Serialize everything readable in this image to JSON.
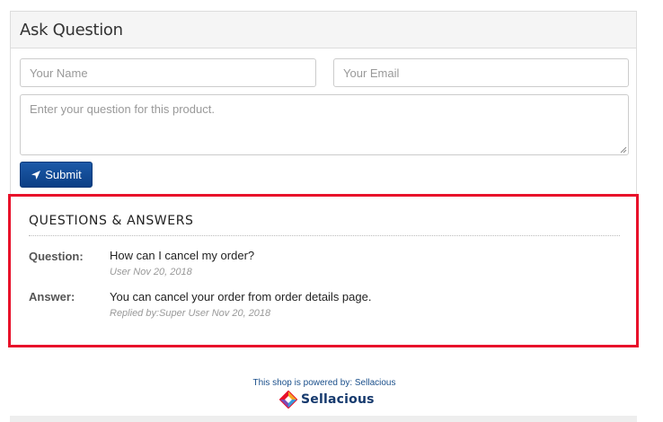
{
  "ask": {
    "title": "Ask Question",
    "name_placeholder": "Your Name",
    "email_placeholder": "Your Email",
    "question_placeholder": "Enter your question for this product.",
    "submit_label": "Submit",
    "submit_icon": "paper-plane-icon"
  },
  "qa": {
    "heading": "QUESTIONS & ANSWERS",
    "question_label": "Question:",
    "question_text": "How can I cancel my order?",
    "question_meta": "User Nov 20, 2018",
    "answer_label": "Answer:",
    "answer_text": "You can cancel your order from order details page.",
    "answer_meta": "Replied by:Super User Nov 20, 2018"
  },
  "footer": {
    "powered_text": "This shop is powered by: Sellacious",
    "logo_text": "Sellacious"
  },
  "colors": {
    "highlight_border": "#e8102a",
    "submit_bg": "#0b3f85",
    "footer_link": "#1a4f8b"
  }
}
